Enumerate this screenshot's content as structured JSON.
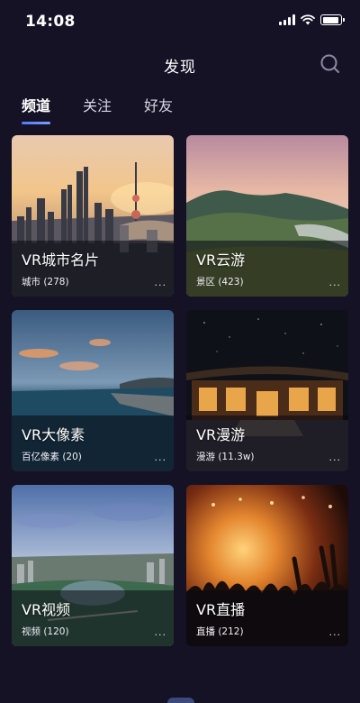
{
  "status_bar": {
    "time": "14:08",
    "battery_level": 0.9
  },
  "header": {
    "title": "发现"
  },
  "tabs": [
    {
      "label": "频道",
      "active": true
    },
    {
      "label": "关注",
      "active": false
    },
    {
      "label": "好友",
      "active": false
    }
  ],
  "cards": [
    {
      "title": "VR城市名片",
      "subtitle": "城市 (278)",
      "more": "..."
    },
    {
      "title": "VR云游",
      "subtitle": "景区 (423)",
      "more": "..."
    },
    {
      "title": "VR大像素",
      "subtitle": "百亿像素 (20)",
      "more": "..."
    },
    {
      "title": "VR漫游",
      "subtitle": "漫游 (11.3w)",
      "more": "..."
    },
    {
      "title": "VR视频",
      "subtitle": "视频 (120)",
      "more": "..."
    },
    {
      "title": "VR直播",
      "subtitle": "直播 (212)",
      "more": "..."
    }
  ],
  "colors": {
    "background": "#161226",
    "accent": "#4e7bff"
  }
}
